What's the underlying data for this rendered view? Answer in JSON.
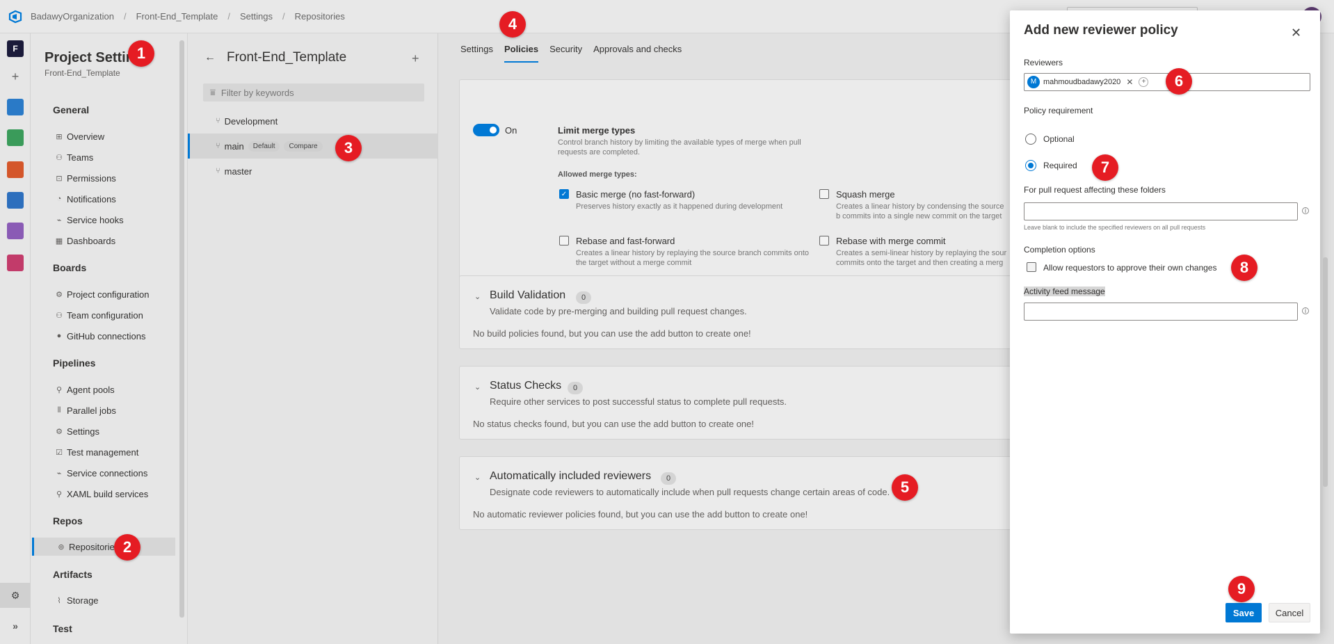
{
  "breadcrumb": [
    "BadawyOrganization",
    "Front-End_Template",
    "Settings",
    "Repositories"
  ],
  "rail": {
    "project_initial": "F"
  },
  "nav": {
    "title": "Project Settings",
    "subtitle": "Front-End_Template",
    "sections": {
      "general": "General",
      "boards": "Boards",
      "pipelines": "Pipelines",
      "repos": "Repos",
      "artifacts": "Artifacts",
      "test": "Test"
    },
    "general_items": [
      "Overview",
      "Teams",
      "Permissions",
      "Notifications",
      "Service hooks",
      "Dashboards"
    ],
    "boards_items": [
      "Project configuration",
      "Team configuration",
      "GitHub connections"
    ],
    "pipelines_items": [
      "Agent pools",
      "Parallel jobs",
      "Settings",
      "Test management",
      "Service connections",
      "XAML build services"
    ],
    "repos_items": [
      "Repositories"
    ],
    "artifacts_items": [
      "Storage"
    ]
  },
  "branches": {
    "title": "Front-End_Template",
    "filter_placeholder": "Filter by keywords",
    "items": [
      {
        "name": "Development"
      },
      {
        "name": "main",
        "tags": [
          "Default",
          "Compare"
        ]
      },
      {
        "name": "master"
      }
    ]
  },
  "tabs": [
    "Settings",
    "Policies",
    "Security",
    "Approvals and checks"
  ],
  "merge": {
    "toggle_label": "On",
    "title": "Limit merge types",
    "desc": "Control branch history by limiting the available types of merge when pull requests are completed.",
    "allowed_label": "Allowed merge types:",
    "options": [
      {
        "label": "Basic merge (no fast-forward)",
        "desc": "Preserves history exactly as it happened during development",
        "checked": true
      },
      {
        "label": "Squash merge",
        "desc": "Creates a linear history by condensing the source b commits into a single new commit on the target br",
        "checked": false
      },
      {
        "label": "Rebase and fast-forward",
        "desc": "Creates a linear history by replaying the source branch commits onto the target without a merge commit",
        "checked": false
      },
      {
        "label": "Rebase with merge commit",
        "desc": "Creates a semi-linear history by replaying the sour commits onto the target and then creating a merg",
        "checked": false
      }
    ]
  },
  "sections": [
    {
      "title": "Build Validation",
      "count": "0",
      "desc": "Validate code by pre-merging and building pull request changes.",
      "empty": "No build policies found, but you can use the add button to create one!"
    },
    {
      "title": "Status Checks",
      "count": "0",
      "desc": "Require other services to post successful status to complete pull requests.",
      "empty": "No status checks found, but you can use the add button to create one!"
    },
    {
      "title": "Automatically included reviewers",
      "count": "0",
      "desc": "Designate code reviewers to automatically include when pull requests change certain areas of code.",
      "empty": "No automatic reviewer policies found, but you can use the add button to create one!"
    }
  ],
  "dialog": {
    "title": "Add new reviewer policy",
    "reviewers_label": "Reviewers",
    "reviewer_initial": "M",
    "reviewer_name": "mahmoudbadawy2020",
    "policy_label": "Policy requirement",
    "optional": "Optional",
    "required": "Required",
    "folders_label": "For pull request affecting these folders",
    "folders_hint": "Leave blank to include the specified reviewers on all pull requests",
    "completion_label": "Completion options",
    "allow_label": "Allow requestors to approve their own changes",
    "activity_label": "Activity feed message",
    "save": "Save",
    "cancel": "Cancel"
  },
  "markers": [
    "1",
    "2",
    "3",
    "4",
    "5",
    "6",
    "7",
    "8",
    "9"
  ],
  "colors": {
    "accent": "#0078d4",
    "marker": "#e51c23"
  }
}
